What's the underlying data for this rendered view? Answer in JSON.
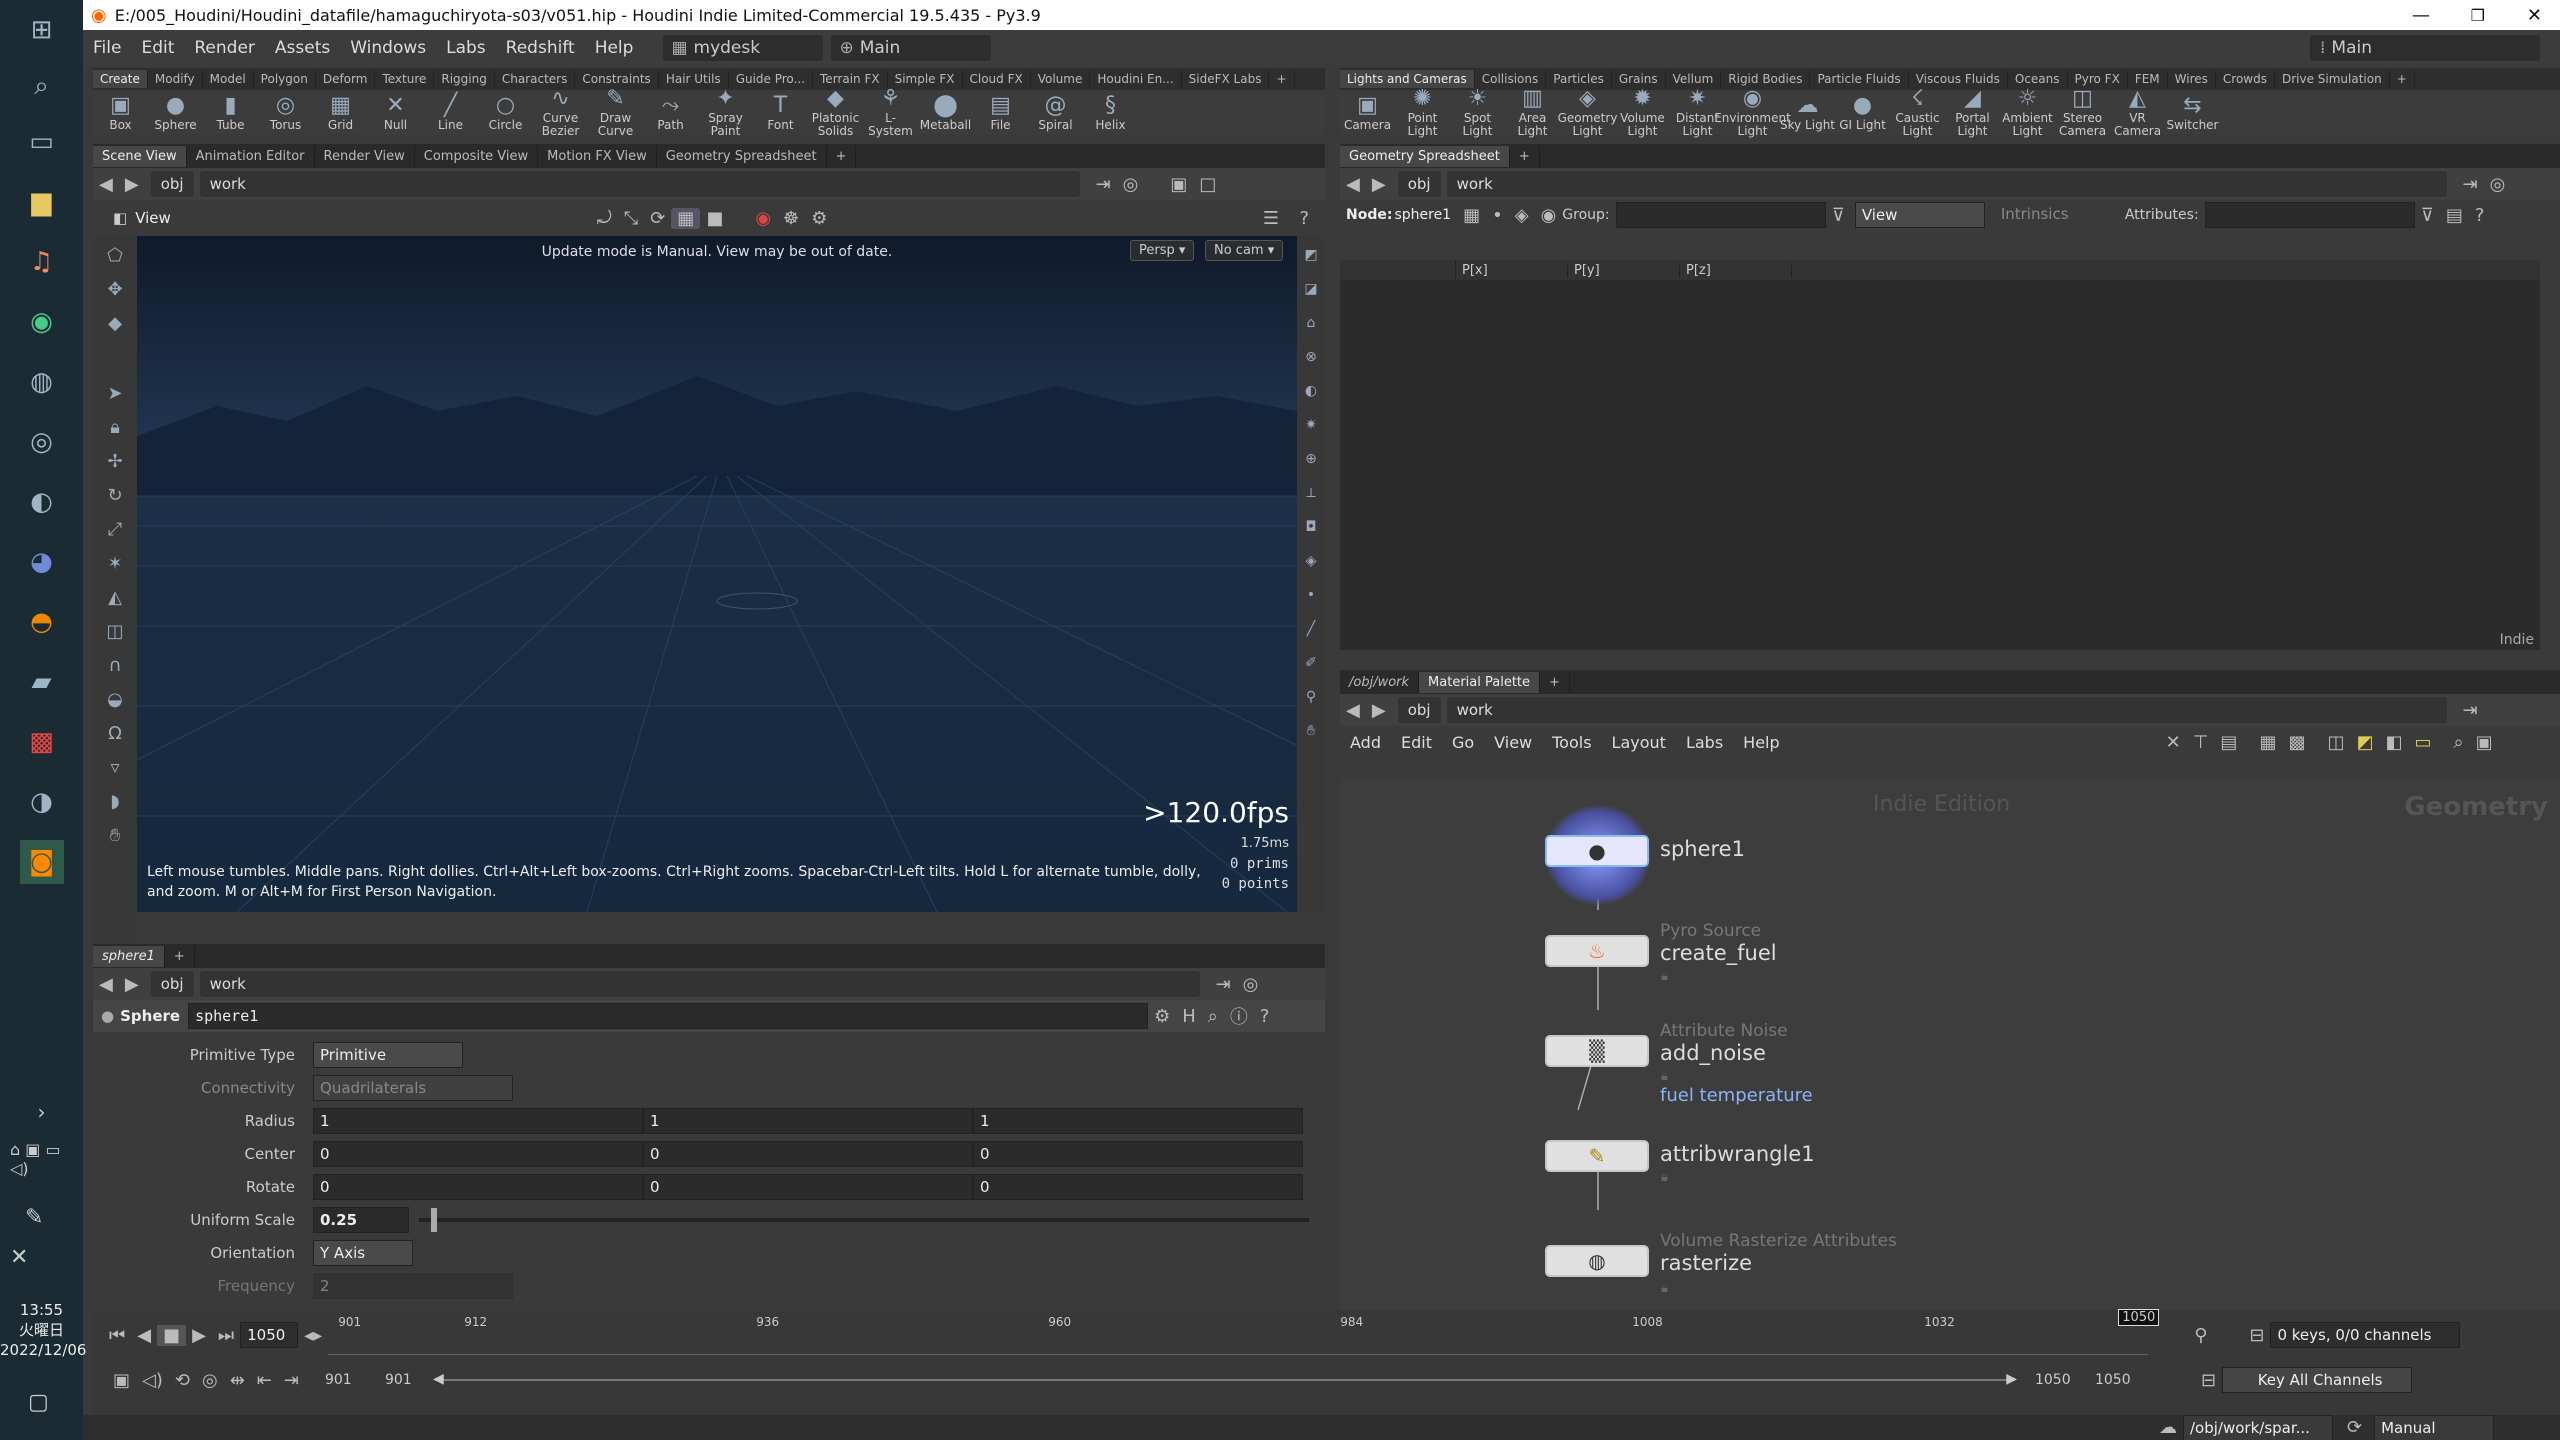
{
  "taskbar": {
    "time": "13:55",
    "day": "火曜日",
    "date": "2022/12/06"
  },
  "window": {
    "title": "E:/005_Houdini/Houdini_datafile/hamaguchiryota-s03/v051.hip - Houdini Indie Limited-Commercial 19.5.435 - Py3.9"
  },
  "menu": [
    "File",
    "Edit",
    "Render",
    "Assets",
    "Windows",
    "Labs",
    "Redshift",
    "Help"
  ],
  "desktop": "mydesk",
  "desktop_sel": "Main",
  "right_desktop": "Main",
  "shelf_left_tabs": [
    "Create",
    "Modify",
    "Model",
    "Polygon",
    "Deform",
    "Texture",
    "Rigging",
    "Characters",
    "Constraints",
    "Hair Utils",
    "Guide Pro...",
    "Terrain FX",
    "Simple FX",
    "Cloud FX",
    "Volume",
    "Houdini En...",
    "SideFX Labs"
  ],
  "shelf_left_tools": [
    {
      "label": "Box",
      "icon": "box-icon",
      "glyph": "▣"
    },
    {
      "label": "Sphere",
      "icon": "sphere-icon",
      "glyph": "●"
    },
    {
      "label": "Tube",
      "icon": "tube-icon",
      "glyph": "▮"
    },
    {
      "label": "Torus",
      "icon": "torus-icon",
      "glyph": "◎"
    },
    {
      "label": "Grid",
      "icon": "grid-icon",
      "glyph": "▦"
    },
    {
      "label": "Null",
      "icon": "null-icon",
      "glyph": "✕"
    },
    {
      "label": "Line",
      "icon": "line-icon",
      "glyph": "╱"
    },
    {
      "label": "Circle",
      "icon": "circle-icon",
      "glyph": "○"
    },
    {
      "label": "Curve Bezier",
      "icon": "curve-bezier-icon",
      "glyph": "∿"
    },
    {
      "label": "Draw Curve",
      "icon": "draw-curve-icon",
      "glyph": "✎"
    },
    {
      "label": "Path",
      "icon": "path-icon",
      "glyph": "⤳"
    },
    {
      "label": "Spray Paint",
      "icon": "spray-paint-icon",
      "glyph": "✦"
    },
    {
      "label": "Font",
      "icon": "font-icon",
      "glyph": "T"
    },
    {
      "label": "Platonic Solids",
      "icon": "platonic-icon",
      "glyph": "◆"
    },
    {
      "label": "L-System",
      "icon": "lsystem-icon",
      "glyph": "⚘"
    },
    {
      "label": "Metaball",
      "icon": "metaball-icon",
      "glyph": "⬤"
    },
    {
      "label": "File",
      "icon": "file-icon",
      "glyph": "▤"
    },
    {
      "label": "Spiral",
      "icon": "spiral-icon",
      "glyph": "@"
    },
    {
      "label": "Helix",
      "icon": "helix-icon",
      "glyph": "§"
    }
  ],
  "shelf_right_tabs": [
    "Lights and Cameras",
    "Collisions",
    "Particles",
    "Grains",
    "Vellum",
    "Rigid Bodies",
    "Particle Fluids",
    "Viscous Fluids",
    "Oceans",
    "Pyro FX",
    "FEM",
    "Wires",
    "Crowds",
    "Drive Simulation"
  ],
  "shelf_right_tools": [
    {
      "label": "Camera",
      "icon": "camera-icon",
      "glyph": "▣"
    },
    {
      "label": "Point Light",
      "icon": "point-light-icon",
      "glyph": "✺"
    },
    {
      "label": "Spot Light",
      "icon": "spot-light-icon",
      "glyph": "☀"
    },
    {
      "label": "Area Light",
      "icon": "area-light-icon",
      "glyph": "▥"
    },
    {
      "label": "Geometry Light",
      "icon": "geometry-light-icon",
      "glyph": "◈"
    },
    {
      "label": "Volume Light",
      "icon": "volume-light-icon",
      "glyph": "✹"
    },
    {
      "label": "Distant Light",
      "icon": "distant-light-icon",
      "glyph": "✷"
    },
    {
      "label": "Environment Light",
      "icon": "environment-light-icon",
      "glyph": "◉"
    },
    {
      "label": "Sky Light",
      "icon": "sky-light-icon",
      "glyph": "☁"
    },
    {
      "label": "GI Light",
      "icon": "gi-light-icon",
      "glyph": "●"
    },
    {
      "label": "Caustic Light",
      "icon": "caustic-light-icon",
      "glyph": "☇"
    },
    {
      "label": "Portal Light",
      "icon": "portal-light-icon",
      "glyph": "◢"
    },
    {
      "label": "Ambient Light",
      "icon": "ambient-light-icon",
      "glyph": "☼"
    },
    {
      "label": "Stereo Camera",
      "icon": "stereo-camera-icon",
      "glyph": "◫"
    },
    {
      "label": "VR Camera",
      "icon": "vr-camera-icon",
      "glyph": "◭"
    },
    {
      "label": "Switcher",
      "icon": "switcher-icon",
      "glyph": "⇆"
    }
  ],
  "scene_tabs": [
    "Scene View",
    "Animation Editor",
    "Render View",
    "Composite View",
    "Motion FX View",
    "Geometry Spreadsheet"
  ],
  "path": {
    "obj": "obj",
    "work": "work"
  },
  "viewport": {
    "label": "View",
    "notice": "Update mode is Manual. View may be out of date.",
    "persp": "Persp ▾",
    "cam": "No cam ▾",
    "fps": ">120.0fps",
    "ms": "1.75ms",
    "prims": "0 prims",
    "points": "0 points",
    "hint": "Left mouse tumbles. Middle pans. Right dollies. Ctrl+Alt+Left box-zooms. Ctrl+Right zooms. Spacebar-Ctrl-Left tilts. Hold L for alternate tumble, dolly, and zoom.    M or Alt+M for First Person Navigation."
  },
  "param_tab": "sphere1",
  "params": {
    "type": "Sphere",
    "name": "sphere1",
    "primitive_type_label": "Primitive Type",
    "primitive_type": "Primitive",
    "connectivity_label": "Connectivity",
    "connectivity": "Quadrilaterals",
    "radius_label": "Radius",
    "radius": [
      "1",
      "1",
      "1"
    ],
    "center_label": "Center",
    "center": [
      "0",
      "0",
      "0"
    ],
    "rotate_label": "Rotate",
    "rotate": [
      "0",
      "0",
      "0"
    ],
    "uniform_scale_label": "Uniform Scale",
    "uniform_scale": "0.25",
    "uniform_scale_fraction": 0.013,
    "orientation_label": "Orientation",
    "orientation": "Y Axis",
    "frequency_label": "Frequency",
    "frequency": "2"
  },
  "spreadsheet": {
    "tab": "Geometry Spreadsheet",
    "node_label": "Node:",
    "node": "sphere1",
    "group_label": "Group:",
    "view": "View",
    "intrinsics": "Intrinsics",
    "attributes_label": "Attributes:",
    "columns": [
      "P[x]",
      "P[y]",
      "P[z]"
    ],
    "watermark": "Indie"
  },
  "network": {
    "tabs": [
      "/obj/work",
      "Material Palette"
    ],
    "menu": [
      "Add",
      "Edit",
      "Go",
      "View",
      "Tools",
      "Layout",
      "Labs",
      "Help"
    ],
    "edition": "Indie Edition",
    "context": "Geometry",
    "nodes": [
      {
        "name": "sphere1",
        "type": "",
        "sub": ""
      },
      {
        "name": "create_fuel",
        "type": "Pyro Source",
        "sub": ""
      },
      {
        "name": "add_noise",
        "type": "Attribute Noise",
        "sub": "fuel temperature"
      },
      {
        "name": "attribwrangle1",
        "type": "",
        "sub": ""
      },
      {
        "name": "rasterize",
        "type": "Volume Rasterize Attributes",
        "sub": ""
      }
    ]
  },
  "timeline": {
    "current": "1050",
    "ticks": [
      "901",
      "912",
      "936",
      "960",
      "984",
      "1008",
      "1032"
    ],
    "marker": "1050",
    "range_start": "901",
    "range_start2": "901",
    "range_end": "1050",
    "range_end2": "1050",
    "keys": "0 keys, 0/0 channels",
    "key_all": "Key All Channels",
    "status_path": "/obj/work/spar...",
    "mode": "Manual"
  }
}
